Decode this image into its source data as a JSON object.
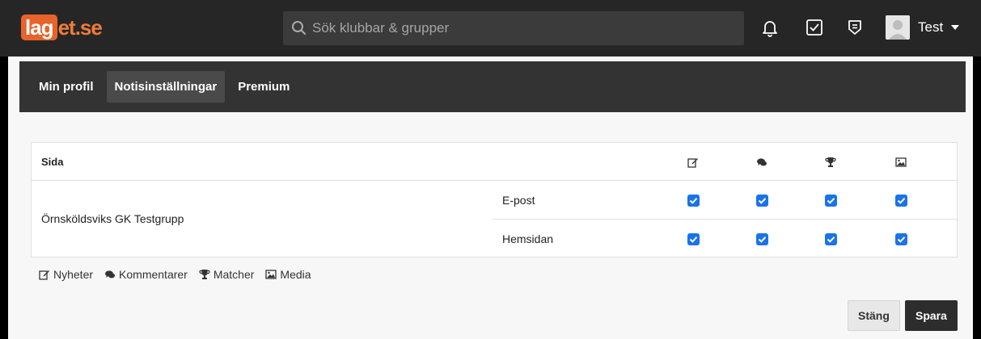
{
  "header": {
    "logo_mark": "lag",
    "logo_rest": "et.se",
    "search_placeholder": "Sök klubbar & grupper",
    "user_name": "Test"
  },
  "tabs": [
    {
      "label": "Min profil",
      "active": false
    },
    {
      "label": "Notisinställningar",
      "active": true
    },
    {
      "label": "Premium",
      "active": false
    }
  ],
  "table": {
    "header_page": "Sida",
    "columns": [
      "Nyheter",
      "Kommentarer",
      "Matcher",
      "Media"
    ],
    "rows": [
      {
        "page": "Örnsköldsviks GK Testgrupp",
        "channels": [
          {
            "label": "E-post",
            "checked": [
              true,
              true,
              true,
              true
            ]
          },
          {
            "label": "Hemsidan",
            "checked": [
              true,
              true,
              true,
              true
            ]
          }
        ]
      }
    ]
  },
  "legend": [
    {
      "icon": "edit-icon",
      "label": "Nyheter"
    },
    {
      "icon": "comments-icon",
      "label": "Kommentarer"
    },
    {
      "icon": "trophy-icon",
      "label": "Matcher"
    },
    {
      "icon": "image-icon",
      "label": "Media"
    }
  ],
  "actions": {
    "close_label": "Stäng",
    "save_label": "Spara"
  },
  "colors": {
    "brand": "#e8632b",
    "checkbox": "#1a73e8",
    "topbar": "#262626"
  }
}
